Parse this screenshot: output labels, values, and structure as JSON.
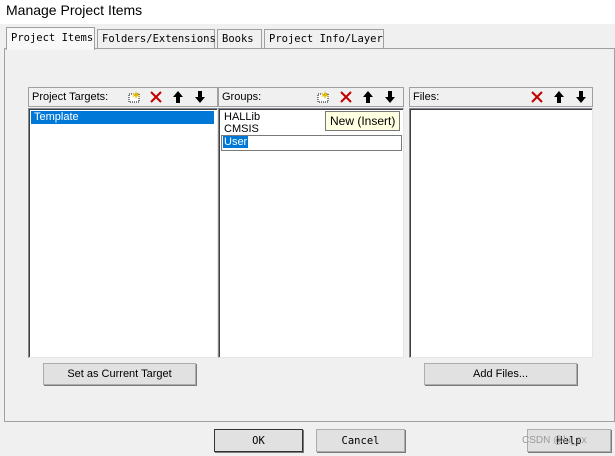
{
  "window": {
    "title": "Manage Project Items"
  },
  "tabs": [
    {
      "label": "Project Items"
    },
    {
      "label": "Folders/Extensions"
    },
    {
      "label": "Books"
    },
    {
      "label": "Project Info/Layer"
    }
  ],
  "targets": {
    "header": "Project Targets:",
    "items": [
      "Template"
    ],
    "selected_index": 0,
    "button": "Set as Current Target"
  },
  "groups": {
    "header": "Groups:",
    "items": [
      "HALLib",
      "CMSIS"
    ],
    "edit_value": "User"
  },
  "files": {
    "header": "Files:",
    "button": "Add Files..."
  },
  "tooltip": {
    "text": "New (Insert)"
  },
  "footer": {
    "ok": "OK",
    "cancel": "Cancel",
    "help": "Help"
  },
  "watermark": "CSDN @lu_zx",
  "icons": {
    "new": "new-folder-icon",
    "delete": "delete-x-icon",
    "up": "arrow-up-icon",
    "down": "arrow-down-icon"
  },
  "colors": {
    "selection": "#0078d7",
    "tooltip_bg": "#ffffe1",
    "delete": "#c00000"
  }
}
